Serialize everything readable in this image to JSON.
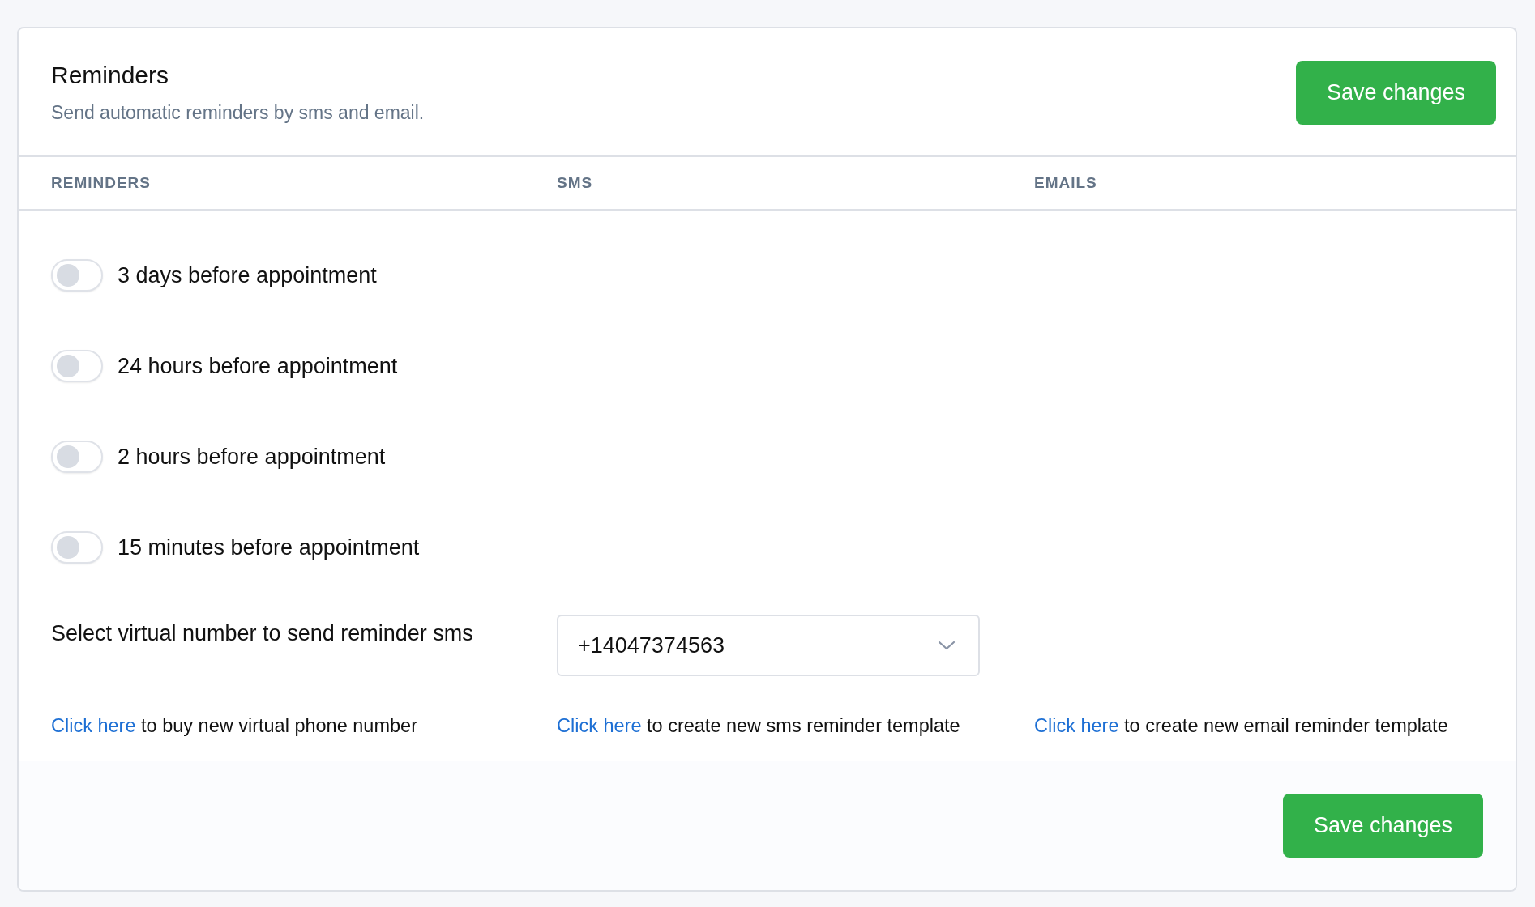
{
  "header": {
    "title": "Reminders",
    "subtitle": "Send automatic reminders by sms and email.",
    "save_button": "Save changes"
  },
  "columns": [
    "REMINDERS",
    "SMS",
    "EMAILS"
  ],
  "reminders": [
    {
      "label": "3 days before appointment",
      "on": false
    },
    {
      "label": "24 hours before appointment",
      "on": false
    },
    {
      "label": "2 hours before appointment",
      "on": false
    },
    {
      "label": "15 minutes before appointment",
      "on": false
    }
  ],
  "virtual_number": {
    "label": "Select virtual number to send reminder sms",
    "value": "+14047374563"
  },
  "links": [
    {
      "link": "Click here",
      "text": "to buy new virtual phone number"
    },
    {
      "link": "Click here",
      "text": "to create new sms reminder template"
    },
    {
      "link": "Click here",
      "text": "to create new email reminder template"
    }
  ],
  "footer": {
    "save_button": "Save changes"
  }
}
